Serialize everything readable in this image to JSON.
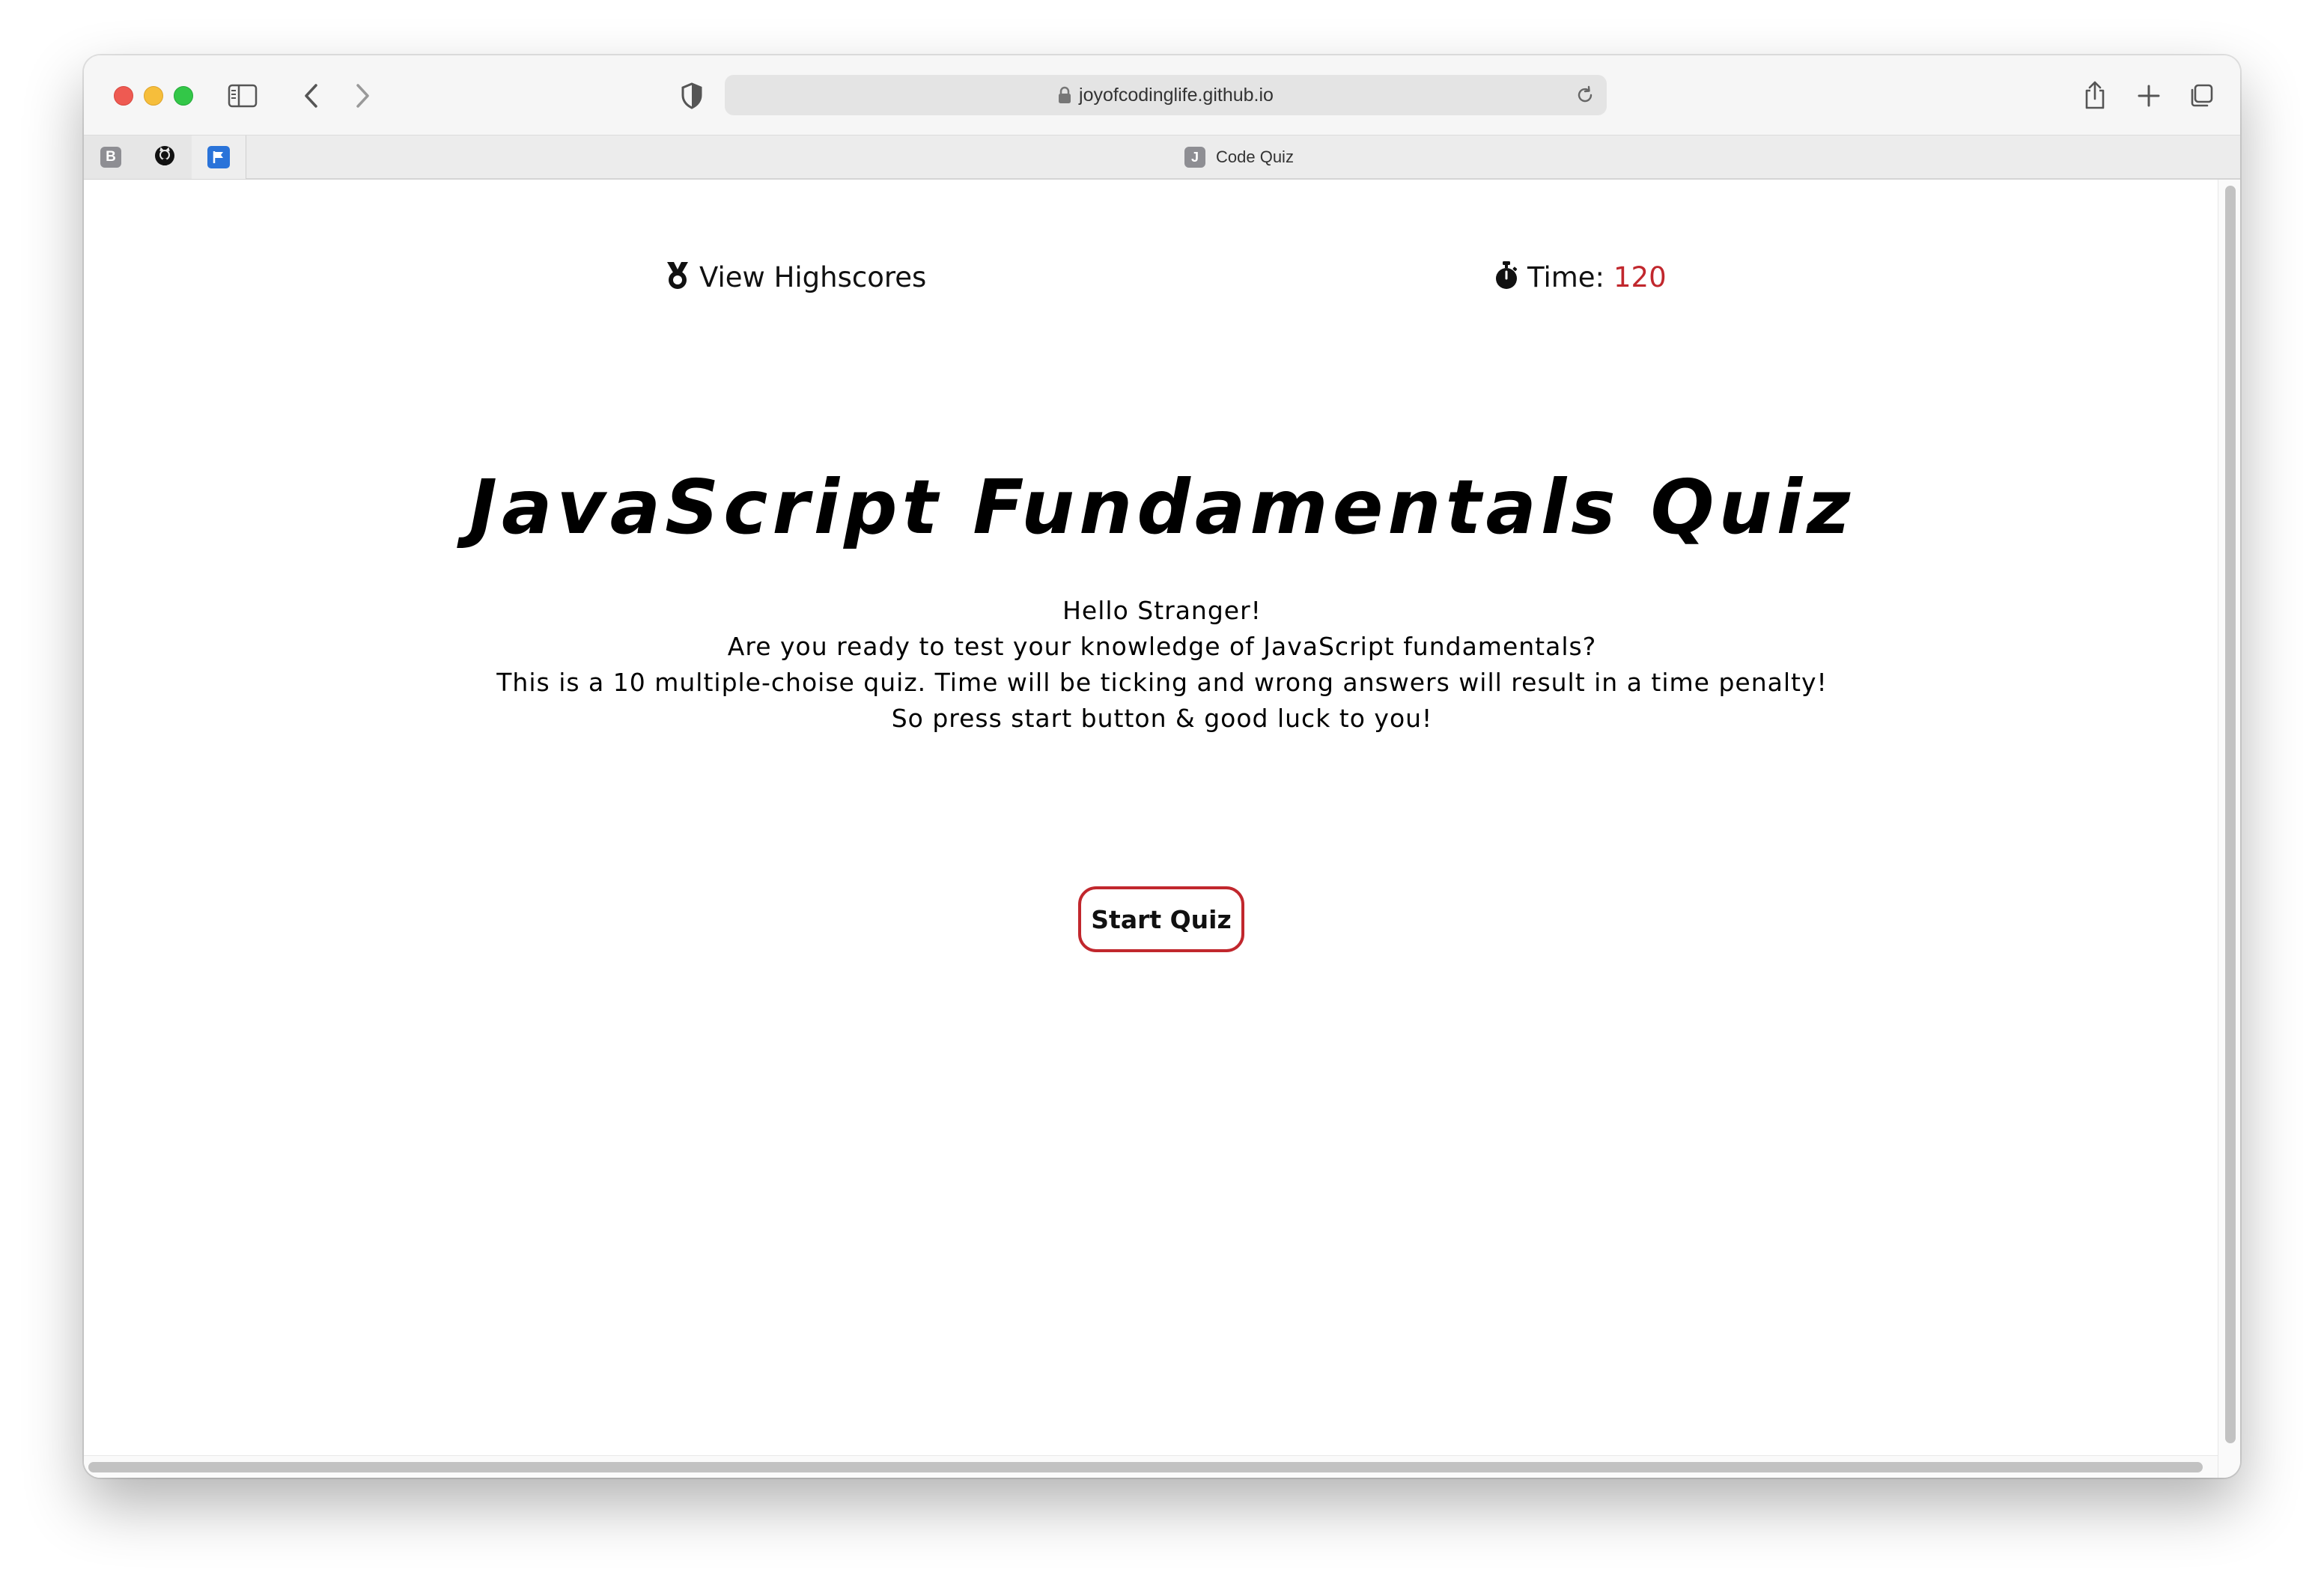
{
  "browser": {
    "url": "joyofcodinglife.github.io",
    "active_tab_title": "Code Quiz",
    "active_tab_favicon_letter": "J",
    "pinned_tabs": [
      {
        "icon": "bookmark-b-icon",
        "letter": "B"
      },
      {
        "icon": "github-icon"
      },
      {
        "icon": "flag-icon"
      }
    ]
  },
  "header": {
    "highscores_icon": "medal-icon",
    "highscores_label": "View Highscores",
    "timer_icon": "stopwatch-icon",
    "timer_label": "Time:",
    "timer_value": "120"
  },
  "main": {
    "title": "JavaScript Fundamentals Quiz",
    "intro_lines": [
      "Hello Stranger!",
      "Are you ready to test your knowledge of JavaScript fundamentals?",
      "This is a 10 multiple-choise quiz. Time will be ticking and wrong answers will result in a time penalty!",
      "So press start button & good luck to you!"
    ],
    "start_button_label": "Start Quiz"
  },
  "colors": {
    "accent": "#c1272d",
    "text": "#000000"
  }
}
